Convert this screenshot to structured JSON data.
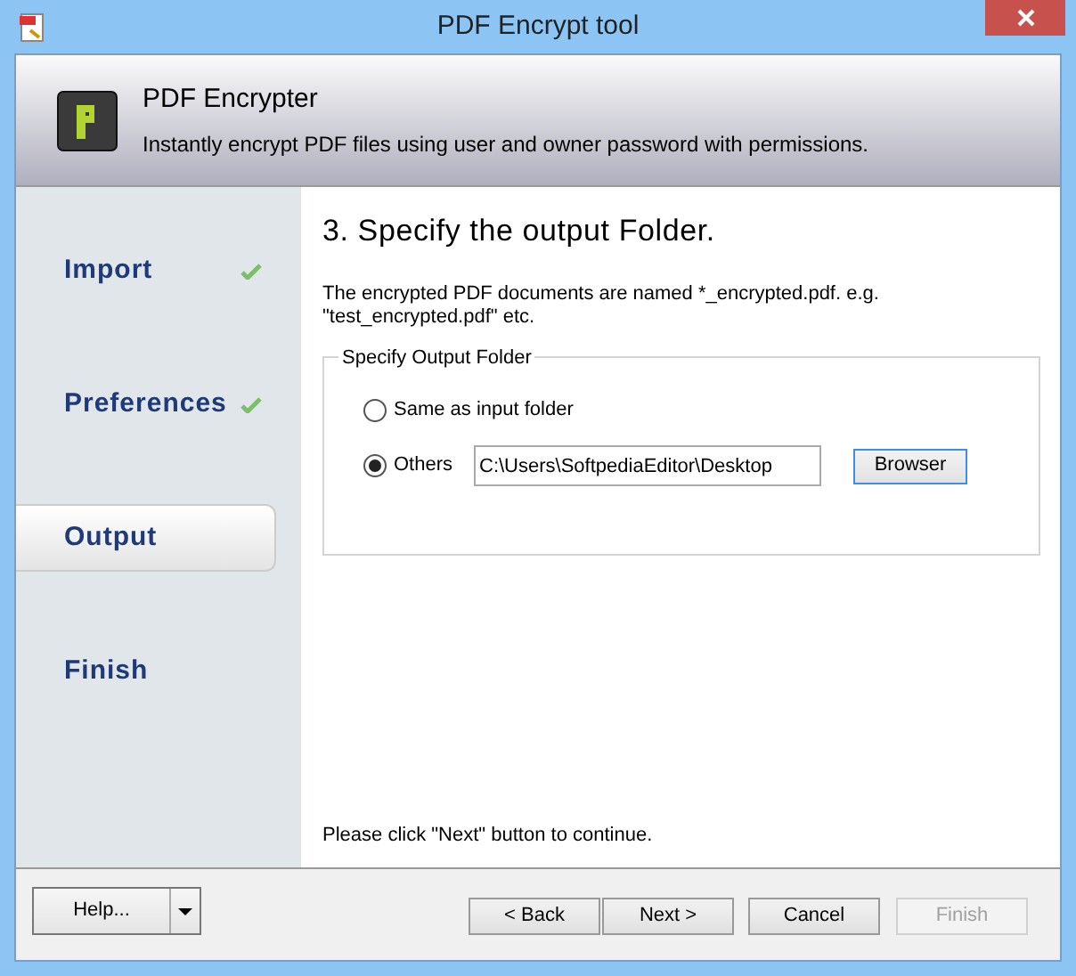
{
  "window": {
    "title": "PDF Encrypt tool"
  },
  "header": {
    "title": "PDF Encrypter",
    "subtitle": "Instantly encrypt PDF files using user and owner password with permissions."
  },
  "steps": [
    {
      "label": "Import",
      "selected": false,
      "done": true
    },
    {
      "label": "Preferences",
      "selected": false,
      "done": true
    },
    {
      "label": "Output",
      "selected": true,
      "done": false
    },
    {
      "label": "Finish",
      "selected": false,
      "done": false
    }
  ],
  "page": {
    "heading": "3. Specify the output Folder.",
    "description": "The encrypted PDF documents are named  *_encrypted.pdf.  e.g. \"test_encrypted.pdf\" etc.",
    "group_title": "Specify Output Folder",
    "options": [
      {
        "label": "Same as input folder",
        "selected": false
      },
      {
        "label": "Others",
        "selected": true
      }
    ],
    "folder_value": "C:\\Users\\SoftpediaEditor\\Desktop",
    "browse_button": "Browser",
    "hint": "Please click \"Next\" button to continue."
  },
  "footer": {
    "help": "Help...",
    "buttons": [
      {
        "label": "< Back",
        "disabled": false
      },
      {
        "label": "Next >",
        "disabled": false
      },
      {
        "label": "Cancel",
        "disabled": false
      },
      {
        "label": "Finish",
        "disabled": true
      }
    ]
  }
}
